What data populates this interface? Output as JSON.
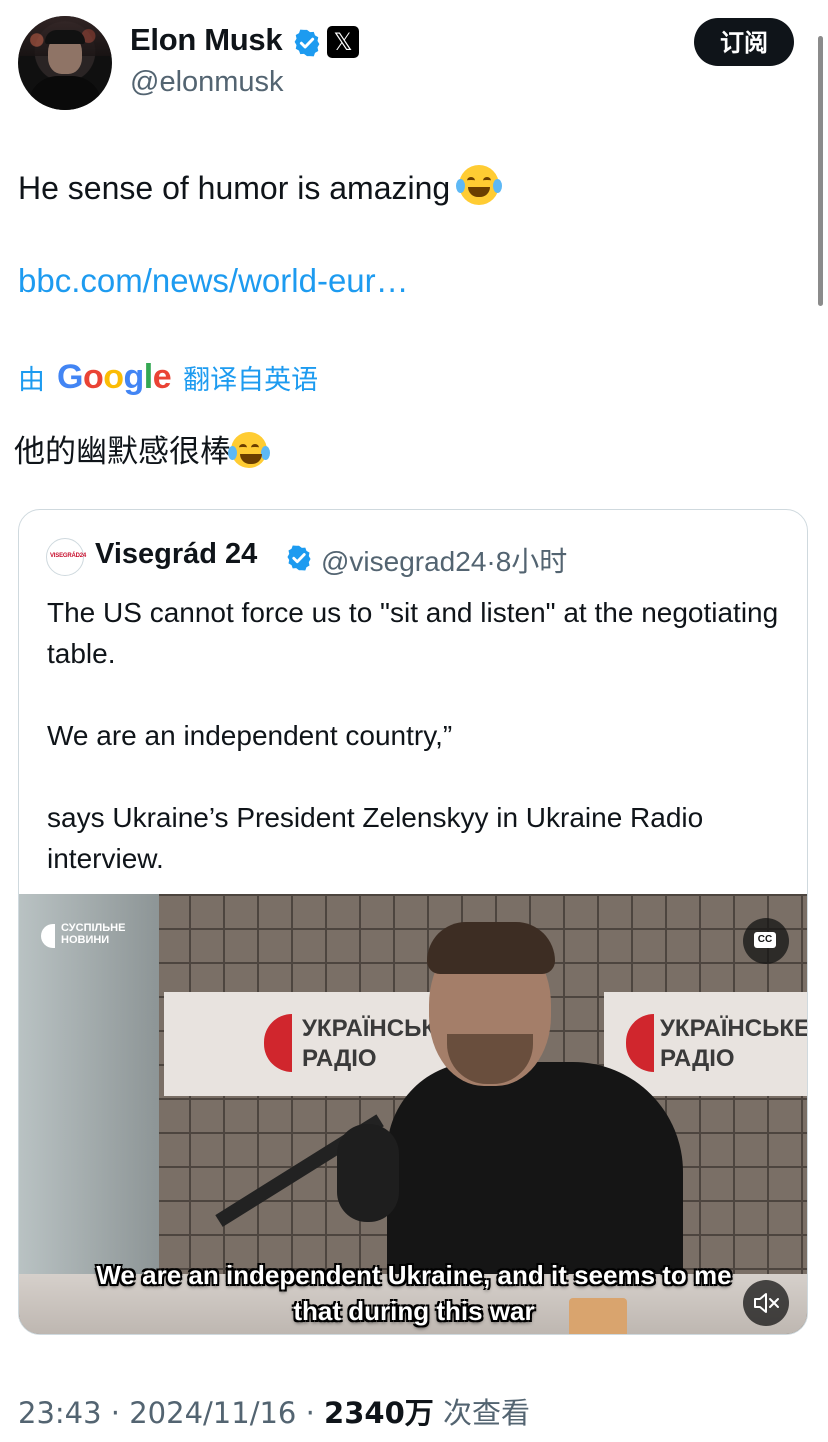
{
  "author": {
    "name": "Elon Musk",
    "handle": "@elonmusk",
    "x_badge": "𝕏"
  },
  "subscribe_label": "订阅",
  "tweet": {
    "text": "He sense of humor is amazing",
    "link": "bbc.com/news/world-eur…",
    "translated_by_prefix": "由",
    "translated_by_brand": "Google",
    "translated_by_suffix": "翻译自英语",
    "translation": "他的幽默感很棒"
  },
  "quote": {
    "avatar_text": "VISEGRÁD24",
    "name": "Visegrád 24",
    "handle": "@visegrad24",
    "time": "·8小时",
    "text": "The US cannot force us to \"sit and listen\" at the negotiating table.\n\nWe are an independent country,”\n\nsays Ukraine’s President Zelenskyy in Ukraine Radio interview.",
    "video": {
      "logo_line1": "СУСПІЛЬНЕ",
      "logo_line2": "НОВИНИ",
      "sign1": "УКРАЇНСЬКЕ\nРАДІО",
      "sign2": "УКРАЇНСЬКЕ\nРАДІО",
      "cc_label": "CC",
      "subtitle_line1": "We are an independent Ukraine, and it seems to me",
      "subtitle_line2": "that during this war"
    }
  },
  "meta": {
    "time": "23:43",
    "date": "· 2024/11/16 ·",
    "views": "2340万",
    "views_label": "次查看"
  },
  "colors": {
    "link_blue": "#1d9bf0",
    "verified_blue": "#1d9bf0",
    "muted_text": "#536471",
    "primary_text": "#0f1419"
  },
  "icons": [
    "verified-badge-icon",
    "x-logo-icon",
    "emoji-tears-of-joy-icon",
    "closed-captions-icon",
    "muted-speaker-icon"
  ]
}
